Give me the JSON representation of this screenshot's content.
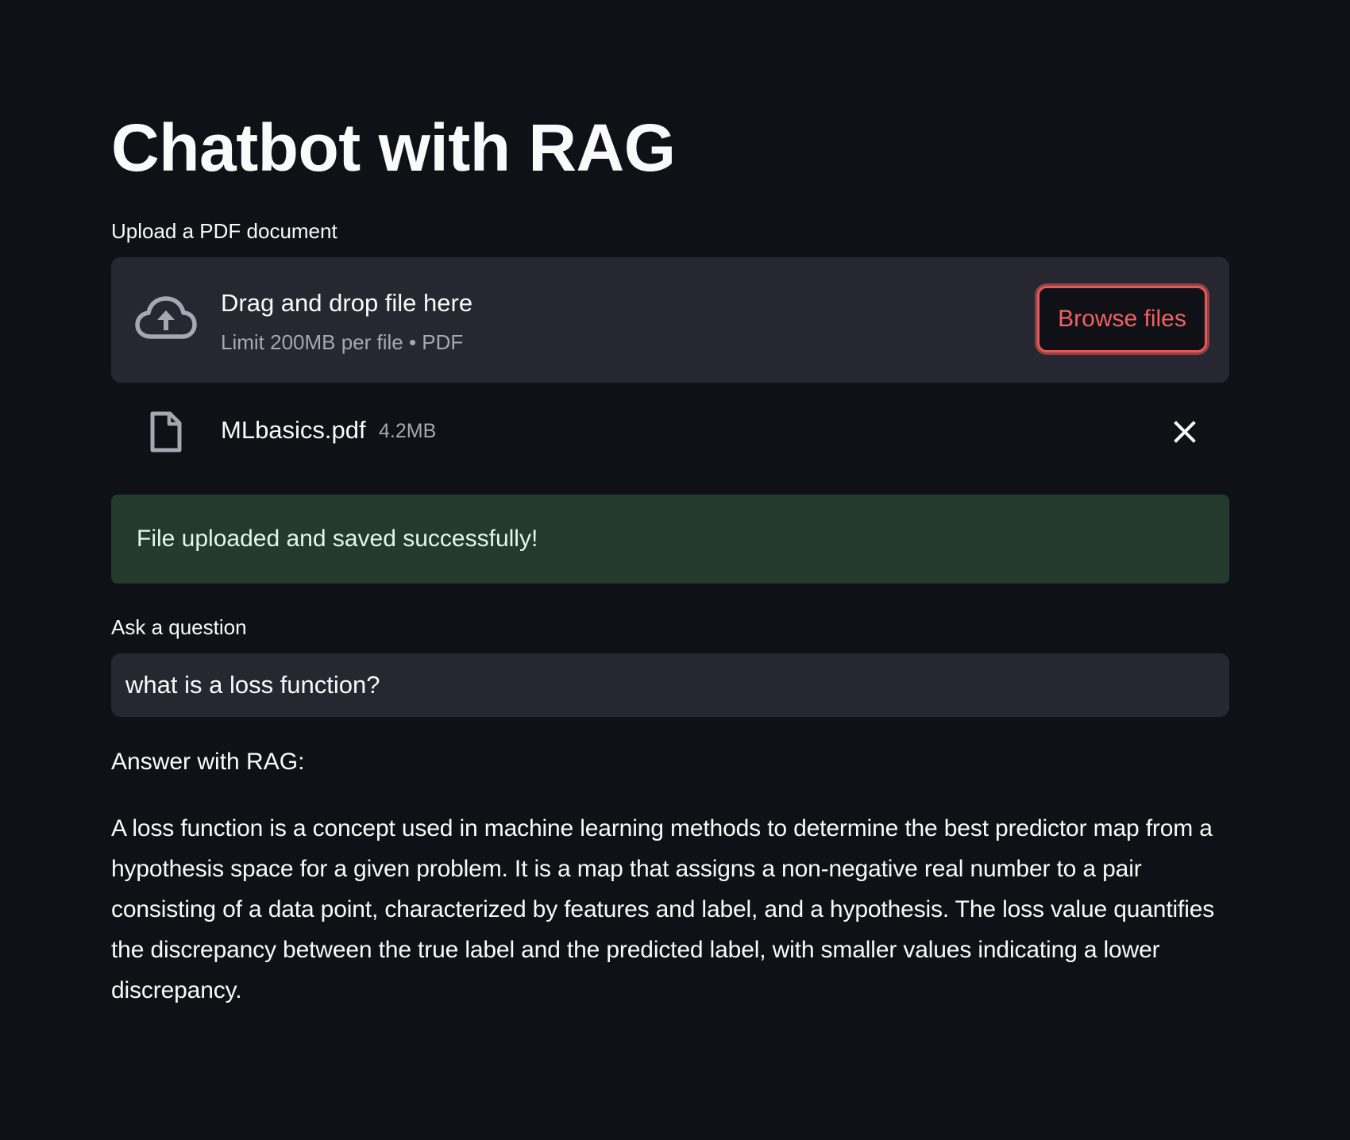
{
  "page": {
    "title": "Chatbot with RAG"
  },
  "uploader": {
    "label": "Upload a PDF document",
    "dropzone_title": "Drag and drop file here",
    "dropzone_limit": "Limit 200MB per file • PDF",
    "browse_label": "Browse files",
    "icon": "cloud-upload-icon"
  },
  "uploaded_file": {
    "name": "MLbasics.pdf",
    "size": "4.2MB",
    "icon": "file-icon",
    "remove_icon": "close-icon"
  },
  "status": {
    "success_message": "File uploaded and saved successfully!"
  },
  "question": {
    "label": "Ask a question",
    "value": "what is a loss function?"
  },
  "answer": {
    "heading": "Answer with RAG:",
    "text": "A loss function is a concept used in machine learning methods to determine the best predictor map from a hypothesis space for a given problem. It is a map that assigns a non-negative real number to a pair consisting of a data point, characterized by features and label, and a hypothesis. The loss value quantifies the discrepancy between the true label and the predicted label, with smaller values indicating a lower discrepancy."
  },
  "colors": {
    "background": "#0f1117",
    "panel": "#262730",
    "accent": "#ff4b4b",
    "success_bg": "#233a2c"
  }
}
